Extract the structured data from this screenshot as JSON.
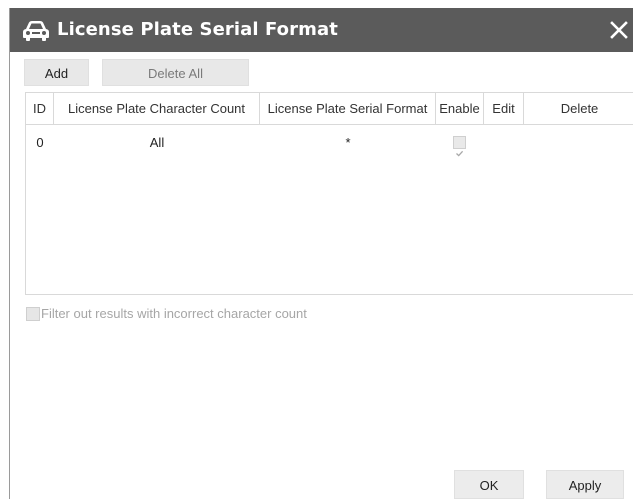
{
  "dialog": {
    "title": "License Plate Serial Format",
    "title_icon": "car-icon",
    "close_icon": "close-icon"
  },
  "toolbar": {
    "add_label": "Add",
    "delete_all_label": "Delete All"
  },
  "table": {
    "headers": {
      "id": "ID",
      "count": "License Plate Character Count",
      "format": "License Plate Serial Format",
      "enable": "Enable",
      "edit": "Edit",
      "delete": "Delete"
    },
    "rows": [
      {
        "id": "0",
        "count": "All",
        "format": "*",
        "enable": true
      }
    ]
  },
  "filter": {
    "label": "Filter out results with incorrect character count",
    "checked": false
  },
  "footer": {
    "ok_label": "OK",
    "apply_label": "Apply"
  },
  "colors": {
    "titlebar": "#5b5b5b",
    "button_bg": "#e8e8e8",
    "disabled_text": "#a6a6a6"
  }
}
